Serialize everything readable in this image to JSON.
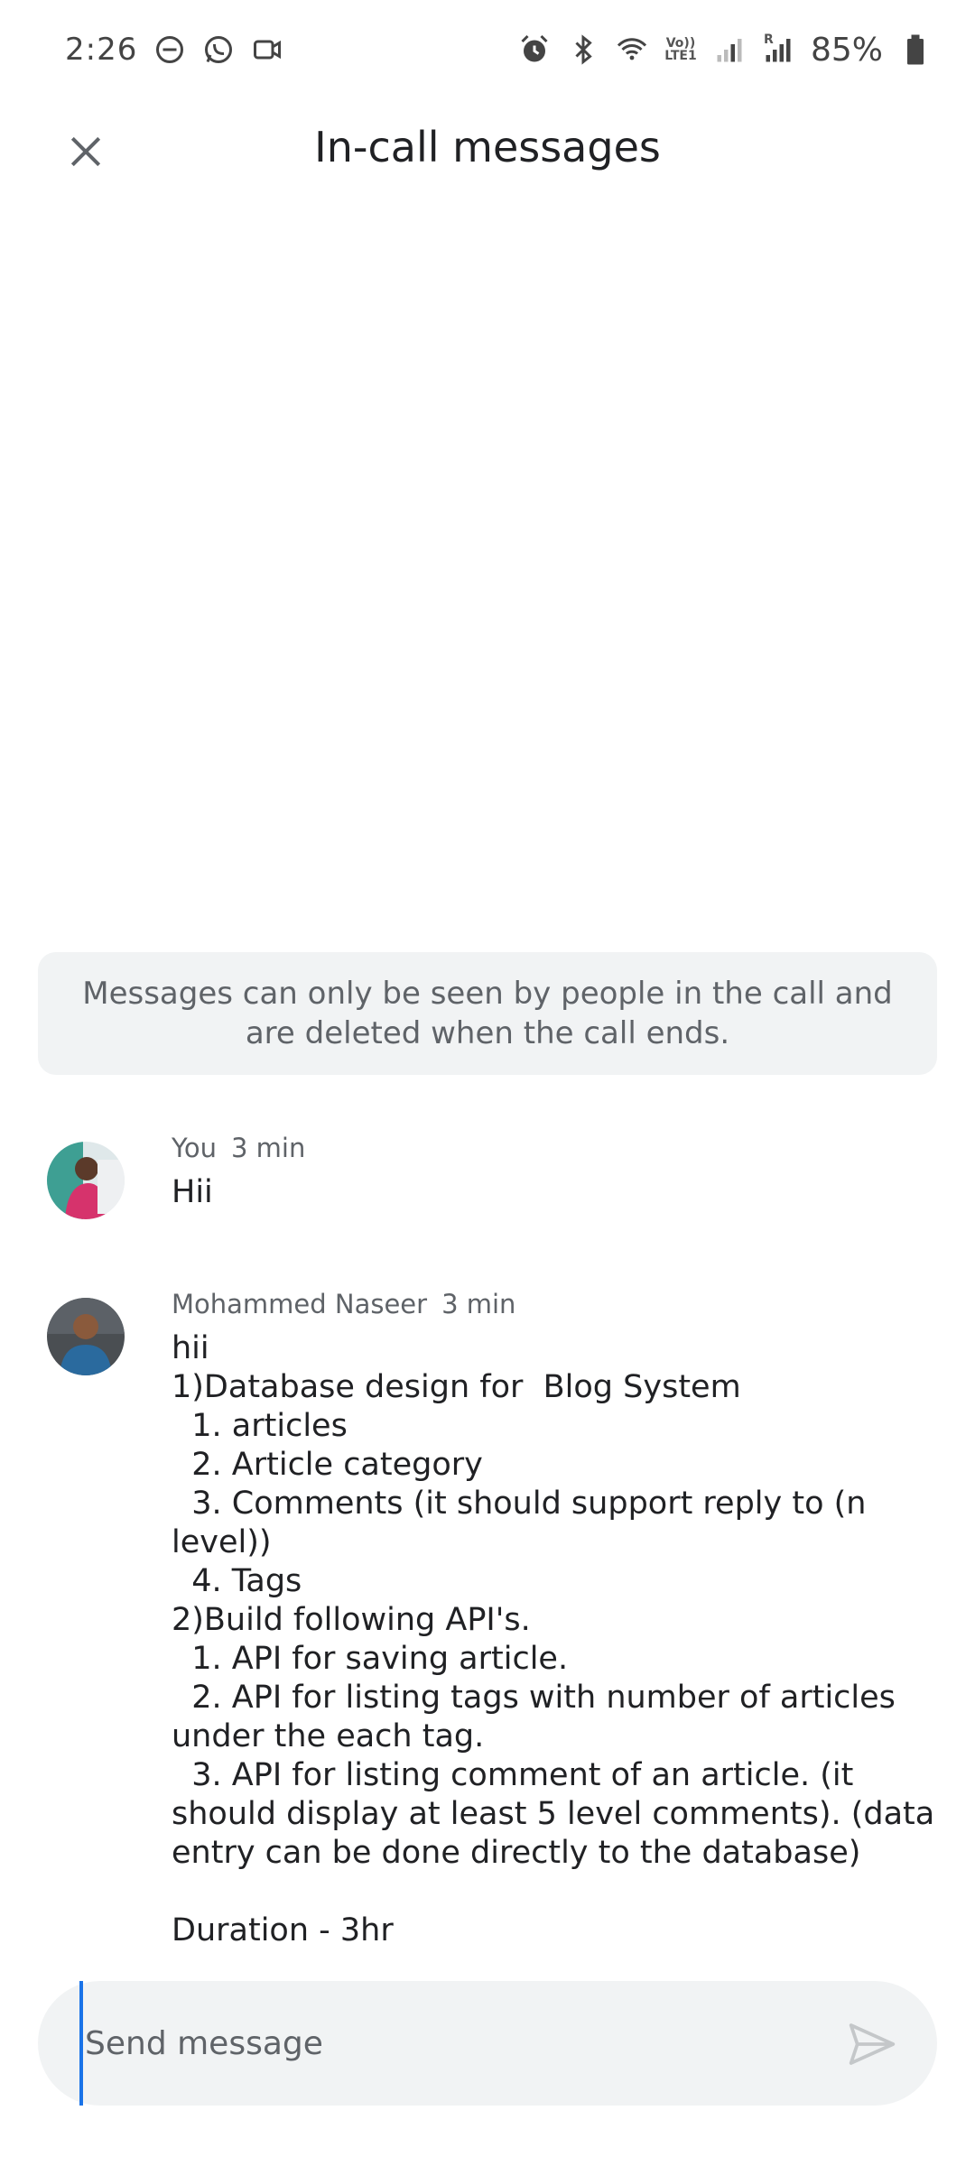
{
  "status_bar": {
    "time": "2:26",
    "battery_percent": "85%",
    "volte_label": "Vo))\nLTE1",
    "roaming_label": "R",
    "icons_left": [
      "do-not-disturb-icon",
      "whatsapp-icon",
      "video-camera-icon"
    ],
    "icons_right": [
      "alarm-icon",
      "bluetooth-icon",
      "wifi-icon",
      "volte-icon",
      "signal-icon",
      "signal-roaming-icon",
      "battery-icon"
    ]
  },
  "header": {
    "title": "In-call messages",
    "close_icon": "close-icon"
  },
  "notice": {
    "text": "Messages can only be seen by people in the call and are deleted when the call ends."
  },
  "messages": [
    {
      "sender": "You",
      "time": "3 min",
      "text": "Hii",
      "avatar_colors": [
        "#3e9f93",
        "#d6336c"
      ]
    },
    {
      "sender": "Mohammed Naseer",
      "time": "3 min",
      "text": "hii\n1)Database design for  Blog System\n  1. articles\n  2. Article category\n  3. Comments (it should support reply to (n level))\n  4. Tags\n2)Build following API's.\n  1. API for saving article.\n  2. API for listing tags with number of articles under the each tag.\n  3. API for listing comment of an article. (it should display at least 5 level comments). (data entry can be done directly to the database)\n\nDuration - 3hr",
      "avatar_colors": [
        "#3b3f44",
        "#2a6a9e"
      ]
    }
  ],
  "composer": {
    "placeholder": "Send message",
    "value": "",
    "send_icon": "send-icon"
  },
  "colors": {
    "accent": "#1a73e8",
    "surface": "#f1f3f4",
    "text_primary": "#202124",
    "text_secondary": "#5f6368"
  }
}
